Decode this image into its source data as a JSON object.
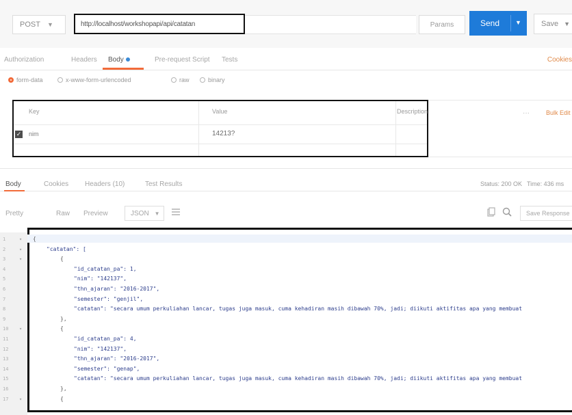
{
  "request": {
    "method": "POST",
    "url": "http://localhost/workshopapi/api/catatan",
    "params_label": "Params",
    "send_label": "Send",
    "save_label": "Save"
  },
  "request_tabs": {
    "authorization": "Authorization",
    "headers": "Headers",
    "body": "Body",
    "pre_request": "Pre-request Script",
    "tests": "Tests",
    "cookies": "Cookies"
  },
  "body_types": {
    "form_data": "form-data",
    "urlencoded": "x-www-form-urlencoded",
    "raw": "raw",
    "binary": "binary",
    "selected": "form-data"
  },
  "form_table": {
    "headers": {
      "key": "Key",
      "value": "Value",
      "description": "Description"
    },
    "row": {
      "key": "nim",
      "value": "14213?",
      "checked": true
    },
    "bulk_edit": "Bulk Edit"
  },
  "response_tabs": {
    "body": "Body",
    "cookies": "Cookies",
    "headers": "Headers (10)",
    "tests": "Test Results",
    "status": "Status: 200 OK",
    "time": "Time: 436 ms"
  },
  "response_toolbar": {
    "pretty": "Pretty",
    "raw": "Raw",
    "preview": "Preview",
    "format": "JSON",
    "save_response": "Save Response"
  },
  "code_lines": [
    {
      "ln": "1",
      "indent": 0,
      "text": "{",
      "cls": "punct"
    },
    {
      "ln": "2",
      "indent": 1,
      "text": "\"catatan\": [",
      "cls": "key"
    },
    {
      "ln": "3",
      "indent": 2,
      "text": "{",
      "cls": "punct"
    },
    {
      "ln": "4",
      "indent": 3,
      "text": "\"id_catatan_pa\": 1,",
      "cls": "key"
    },
    {
      "ln": "5",
      "indent": 3,
      "text": "\"nim\": \"142137\",",
      "cls": "key"
    },
    {
      "ln": "6",
      "indent": 3,
      "text": "\"thn_ajaran\": \"2016-2017\",",
      "cls": "key"
    },
    {
      "ln": "7",
      "indent": 3,
      "text": "\"semester\": \"genjil\",",
      "cls": "key"
    },
    {
      "ln": "8",
      "indent": 3,
      "text": "\"catatan\": \"secara umum perkuliahan lancar, tugas juga masuk, cuma kehadiran masih dibawah 70%, jadi; diikuti aktifitas apa yang membuat",
      "cls": "key"
    },
    {
      "ln": "9",
      "indent": 2,
      "text": "},",
      "cls": "punct"
    },
    {
      "ln": "10",
      "indent": 2,
      "text": "{",
      "cls": "punct"
    },
    {
      "ln": "11",
      "indent": 3,
      "text": "\"id_catatan_pa\": 4,",
      "cls": "key"
    },
    {
      "ln": "12",
      "indent": 3,
      "text": "\"nim\": \"142137\",",
      "cls": "key"
    },
    {
      "ln": "13",
      "indent": 3,
      "text": "\"thn_ajaran\": \"2016-2017\",",
      "cls": "key"
    },
    {
      "ln": "14",
      "indent": 3,
      "text": "\"semester\": \"genap\",",
      "cls": "key"
    },
    {
      "ln": "15",
      "indent": 3,
      "text": "\"catatan\": \"secara umum perkuliahan lancar, tugas juga masuk, cuma kehadiran masih dibawah 70%, jadi; diikuti aktifitas apa yang membuat",
      "cls": "key"
    },
    {
      "ln": "16",
      "indent": 2,
      "text": "},",
      "cls": "punct"
    },
    {
      "ln": "17",
      "indent": 2,
      "text": "{",
      "cls": "punct"
    }
  ],
  "colors": {
    "accent": "#f26b3a",
    "send_button": "#1e7bd9",
    "json_text": "#2d3e8c"
  },
  "icons": [
    "chevron-down-icon",
    "checkbox-icon",
    "wrap-icon",
    "copy-icon",
    "search-icon",
    "fold-arrow-icon"
  ]
}
